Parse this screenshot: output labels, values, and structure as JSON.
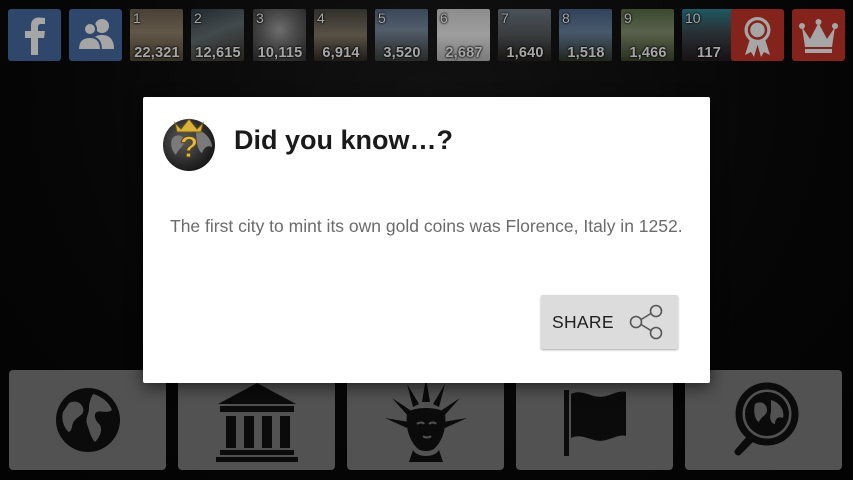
{
  "topbar": {
    "facebook_icon": "facebook-f-icon",
    "friends_icon": "people-icon",
    "leaderboard": [
      {
        "rank": "1",
        "score": "22,321"
      },
      {
        "rank": "2",
        "score": "12,615"
      },
      {
        "rank": "3",
        "score": "10,115"
      },
      {
        "rank": "4",
        "score": "6,914"
      },
      {
        "rank": "5",
        "score": "3,520"
      },
      {
        "rank": "6",
        "score": "2,687"
      },
      {
        "rank": "7",
        "score": "1,640"
      },
      {
        "rank": "8",
        "score": "1,518"
      },
      {
        "rank": "9",
        "score": "1,466"
      },
      {
        "rank": "10",
        "score": "117"
      }
    ],
    "achievements_icon": "award-ribbon-icon",
    "crown_icon": "crown-icon"
  },
  "dialog": {
    "title": "Did you know…?",
    "body": "The first city to mint its own gold coins was Florence, Italy in 1252.",
    "share_label": "SHARE"
  },
  "categories": [
    {
      "icon": "globe-icon"
    },
    {
      "icon": "museum-icon"
    },
    {
      "icon": "statue-of-liberty-icon"
    },
    {
      "icon": "flag-icon"
    },
    {
      "icon": "globe-search-icon"
    }
  ],
  "colors": {
    "facebook_blue": "#4b6ea6",
    "accent_red": "#c9362c",
    "category_gray": "#7f7f7f",
    "dialog_bg": "#ffffff",
    "share_bg": "#dcdcdc"
  }
}
